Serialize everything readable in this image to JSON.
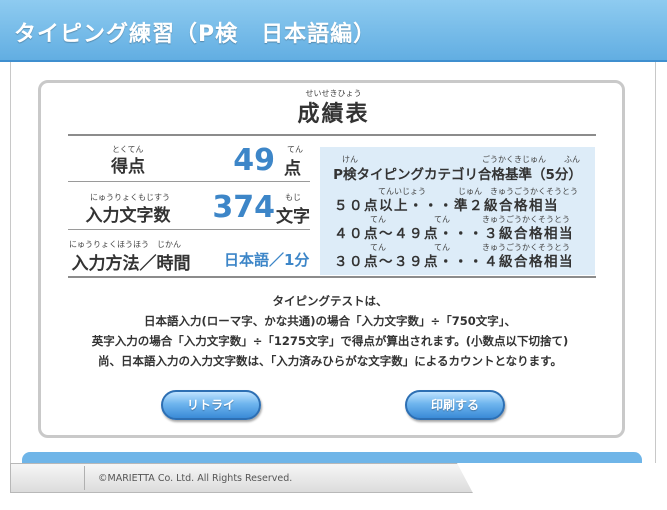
{
  "header": {
    "title": "タイピング練習（P検　日本語編）"
  },
  "card": {
    "title_ruby": "せいせきひょう",
    "title": "成績表",
    "rows": {
      "score": {
        "label_ruby": "とくてん",
        "label": "得点",
        "value": "49",
        "unit_ruby": "てん",
        "unit": "点"
      },
      "chars": {
        "label_ruby": "にゅうりょくもじすう",
        "label": "入力文字数",
        "value": "374",
        "unit_ruby": "もじ",
        "unit": "文字"
      },
      "method": {
        "label_ruby": "にゅうりょくほうほう　じかん",
        "label": "入力方法／時間",
        "value": "日本語／1分"
      }
    },
    "category": {
      "title_ruby_left": "けん",
      "title_ruby_mid": "ごうかくきじゅん",
      "title_ruby_right": "ふん",
      "title": "P検タイピングカテゴリ合格基準（5分）",
      "lines": [
        {
          "ruby": "てんいじょう　　　　じゅん　きゅうごうかくそうとう",
          "text": "５０点以上・・・準２級合格相当"
        },
        {
          "ruby": "てん　　　　　　てん　　　　きゅうごうかくそうとう",
          "text": "４０点～４９点・・・３級合格相当"
        },
        {
          "ruby": "てん　　　　　　てん　　　　きゅうごうかくそうとう",
          "text": "３０点～３９点・・・４級合格相当"
        }
      ]
    },
    "notes": [
      "タイピングテストは、",
      "日本語入力(ローマ字、かな共通)の場合「入力文字数」÷「750文字」、",
      "英字入力の場合「入力文字数」÷「1275文字」で得点が算出されます。(小数点以下切捨て)",
      "尚、日本語入力の入力文字数は、「入力済みひらがな文字数」によるカウントとなります。"
    ],
    "buttons": {
      "retry": "リトライ",
      "print": "印刷する"
    }
  },
  "footer": {
    "copyright": "©MARIETTA Co. Ltd. All Rights Reserved."
  },
  "colors": {
    "accent": "#3d86c8",
    "header": "#62aee2",
    "category_bg": "#ddecf8"
  }
}
